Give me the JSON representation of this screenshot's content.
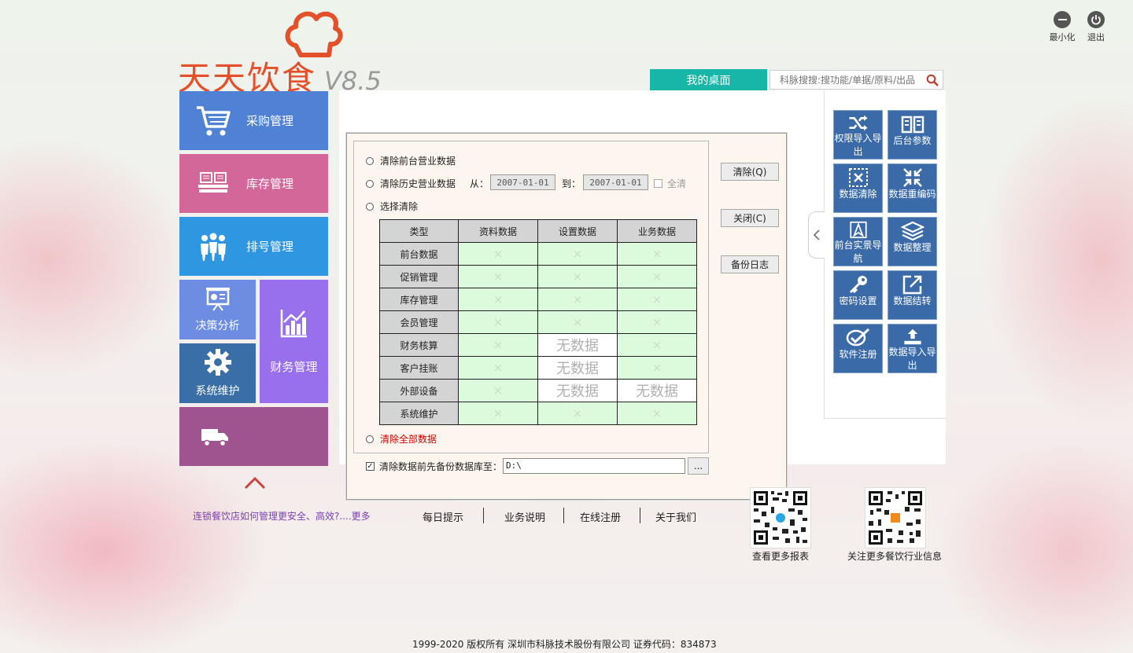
{
  "window": {
    "minimize": "最小化",
    "exit": "退出"
  },
  "logo": {
    "name": "天天饮食",
    "version": "V8.5"
  },
  "menu": {
    "purchase": "采购管理",
    "inventory": "库存管理",
    "queue": "排号管理",
    "decision": "决策分析",
    "finance": "财务管理",
    "system": "系统维护"
  },
  "topbar": {
    "desk_tab": "我的桌面",
    "search_placeholder": "科脉搜搜:搜功能/单据/原料/出品"
  },
  "quick": [
    {
      "label": "权限导入导出",
      "icon": "shuffle-icon"
    },
    {
      "label": "后台参数",
      "icon": "book-icon"
    },
    {
      "label": "数据清除",
      "icon": "clear-data-icon"
    },
    {
      "label": "数据重编码",
      "icon": "compress-icon"
    },
    {
      "label": "前台实景导航",
      "icon": "navigation-icon"
    },
    {
      "label": "数据整理",
      "icon": "layers-icon"
    },
    {
      "label": "密码设置",
      "icon": "key-icon"
    },
    {
      "label": "数据结转",
      "icon": "export-icon"
    },
    {
      "label": "软件注册",
      "icon": "register-icon"
    },
    {
      "label": "数据导入导出",
      "icon": "upload-icon"
    }
  ],
  "dialog": {
    "opt_front": "清除前台营业数据",
    "opt_history": "清除历史营业数据",
    "from_label": "从：",
    "from_date": "2007-01-01",
    "to_label": "到：",
    "to_date": "2007-01-01",
    "all_clear": "全清",
    "opt_select": "选择清除",
    "opt_all": "清除全部数据",
    "backup_label": "清除数据前先备份数据库至：",
    "backup_path": "D:\\",
    "browse": "...",
    "buttons": {
      "clear": "清除(Q)",
      "close": "关闭(C)",
      "log": "备份日志"
    },
    "table": {
      "headers": [
        "类型",
        "资料数据",
        "设置数据",
        "业务数据"
      ],
      "rows": [
        {
          "type": "前台数据",
          "cells": [
            "×",
            "×",
            "×"
          ]
        },
        {
          "type": "促销管理",
          "cells": [
            "×",
            "×",
            "×"
          ]
        },
        {
          "type": "库存管理",
          "cells": [
            "×",
            "×",
            "×"
          ]
        },
        {
          "type": "会员管理",
          "cells": [
            "×",
            "×",
            "×"
          ]
        },
        {
          "type": "财务核算",
          "cells": [
            "×",
            "无数据",
            "×"
          ]
        },
        {
          "type": "客户挂账",
          "cells": [
            "×",
            "无数据",
            "×"
          ]
        },
        {
          "type": "外部设备",
          "cells": [
            "×",
            "无数据",
            "无数据"
          ]
        },
        {
          "type": "系统维护",
          "cells": [
            "×",
            "×",
            "×"
          ]
        }
      ]
    }
  },
  "footer_links": {
    "tip": "连锁餐饮店如何管理更安全、高效?....更多",
    "daily": "每日提示",
    "business": "业务说明",
    "register": "在线注册",
    "about": "关于我们"
  },
  "qr": {
    "reports": "查看更多报表",
    "follow": "关注更多餐饮行业信息"
  },
  "copyright": "1999-2020  版权所有  深圳市科脉技术股份有限公司  证券代码：834873",
  "colors": {
    "purchase": "#4f82d4",
    "inventory": "#d3679a",
    "queue": "#2f97e2",
    "decision": "#6c8de2",
    "finance": "#9870ee",
    "system": "#3a6ea6",
    "delivery": "#a0548f",
    "desk_tab": "#17b6a8",
    "quick_btn": "#3a6aa8"
  }
}
